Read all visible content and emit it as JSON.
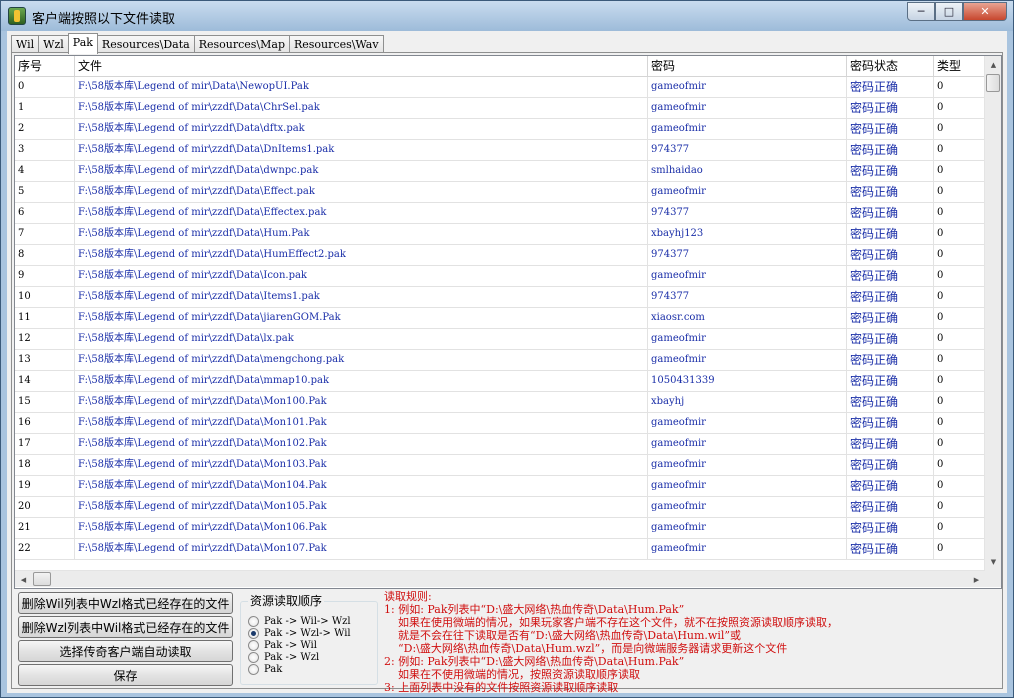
{
  "window": {
    "title": "客户端按照以下文件读取"
  },
  "tabs": [
    {
      "label": "Wil",
      "active": false
    },
    {
      "label": "Wzl",
      "active": false
    },
    {
      "label": "Pak",
      "active": true
    },
    {
      "label": "Resources\\Data",
      "active": false
    },
    {
      "label": "Resources\\Map",
      "active": false
    },
    {
      "label": "Resources\\Wav",
      "active": false
    }
  ],
  "grid": {
    "columns": [
      "序号",
      "文件",
      "密码",
      "密码状态",
      "类型"
    ],
    "rows": [
      [
        "0",
        "F:\\58版本库\\Legend of mir\\Data\\NewopUI.Pak",
        "gameofmir",
        "密码正确",
        "0"
      ],
      [
        "1",
        "F:\\58版本库\\Legend of mir\\zzdf\\Data\\ChrSel.pak",
        "gameofmir",
        "密码正确",
        "0"
      ],
      [
        "2",
        "F:\\58版本库\\Legend of mir\\zzdf\\Data\\dftx.pak",
        "gameofmir",
        "密码正确",
        "0"
      ],
      [
        "3",
        "F:\\58版本库\\Legend of mir\\zzdf\\Data\\DnItems1.pak",
        "974377",
        "密码正确",
        "0"
      ],
      [
        "4",
        "F:\\58版本库\\Legend of mir\\zzdf\\Data\\dwnpc.pak",
        "smlhaidao",
        "密码正确",
        "0"
      ],
      [
        "5",
        "F:\\58版本库\\Legend of mir\\zzdf\\Data\\Effect.pak",
        "gameofmir",
        "密码正确",
        "0"
      ],
      [
        "6",
        "F:\\58版本库\\Legend of mir\\zzdf\\Data\\Effectex.pak",
        "974377",
        "密码正确",
        "0"
      ],
      [
        "7",
        "F:\\58版本库\\Legend of mir\\zzdf\\Data\\Hum.Pak",
        "xbayhj123",
        "密码正确",
        "0"
      ],
      [
        "8",
        "F:\\58版本库\\Legend of mir\\zzdf\\Data\\HumEffect2.pak",
        "974377",
        "密码正确",
        "0"
      ],
      [
        "9",
        "F:\\58版本库\\Legend of mir\\zzdf\\Data\\Icon.pak",
        "gameofmir",
        "密码正确",
        "0"
      ],
      [
        "10",
        "F:\\58版本库\\Legend of mir\\zzdf\\Data\\Items1.pak",
        "974377",
        "密码正确",
        "0"
      ],
      [
        "11",
        "F:\\58版本库\\Legend of mir\\zzdf\\Data\\jiarenGOM.Pak",
        "xiaosr.com",
        "密码正确",
        "0"
      ],
      [
        "12",
        "F:\\58版本库\\Legend of mir\\zzdf\\Data\\lx.pak",
        "gameofmir",
        "密码正确",
        "0"
      ],
      [
        "13",
        "F:\\58版本库\\Legend of mir\\zzdf\\Data\\mengchong.pak",
        "gameofmir",
        "密码正确",
        "0"
      ],
      [
        "14",
        "F:\\58版本库\\Legend of mir\\zzdf\\Data\\mmap10.pak",
        "1050431339",
        "密码正确",
        "0"
      ],
      [
        "15",
        "F:\\58版本库\\Legend of mir\\zzdf\\Data\\Mon100.Pak",
        "xbayhj",
        "密码正确",
        "0"
      ],
      [
        "16",
        "F:\\58版本库\\Legend of mir\\zzdf\\Data\\Mon101.Pak",
        "gameofmir",
        "密码正确",
        "0"
      ],
      [
        "17",
        "F:\\58版本库\\Legend of mir\\zzdf\\Data\\Mon102.Pak",
        "gameofmir",
        "密码正确",
        "0"
      ],
      [
        "18",
        "F:\\58版本库\\Legend of mir\\zzdf\\Data\\Mon103.Pak",
        "gameofmir",
        "密码正确",
        "0"
      ],
      [
        "19",
        "F:\\58版本库\\Legend of mir\\zzdf\\Data\\Mon104.Pak",
        "gameofmir",
        "密码正确",
        "0"
      ],
      [
        "20",
        "F:\\58版本库\\Legend of mir\\zzdf\\Data\\Mon105.Pak",
        "gameofmir",
        "密码正确",
        "0"
      ],
      [
        "21",
        "F:\\58版本库\\Legend of mir\\zzdf\\Data\\Mon106.Pak",
        "gameofmir",
        "密码正确",
        "0"
      ],
      [
        "22",
        "F:\\58版本库\\Legend of mir\\zzdf\\Data\\Mon107.Pak",
        "gameofmir",
        "密码正确",
        "0"
      ]
    ]
  },
  "buttons": {
    "delete_wil": "删除Wil列表中Wzl格式已经存在的文件",
    "delete_wzl": "删除Wzl列表中Wil格式已经存在的文件",
    "select_client": "选择传奇客户端自动读取",
    "save": "保存"
  },
  "read_order": {
    "title": "资源读取顺序",
    "options": [
      {
        "label": "Pak -> Wil-> Wzl",
        "checked": false
      },
      {
        "label": "Pak -> Wzl-> Wil",
        "checked": true
      },
      {
        "label": "Pak -> Wil",
        "checked": false
      },
      {
        "label": "Pak -> Wzl",
        "checked": false
      },
      {
        "label": "Pak",
        "checked": false
      }
    ]
  },
  "rules": {
    "lines": [
      "读取规则:",
      "1: 例如: Pak列表中“D:\\盛大网络\\热血传奇\\Data\\Hum.Pak”",
      "如果在使用微端的情况，如果玩家客户端不存在这个文件，就不在按照资源读取顺序读取，",
      "就是不会在往下读取是否有“D:\\盛大网络\\热血传奇\\Data\\Hum.wil”或",
      "“D:\\盛大网络\\热血传奇\\Data\\Hum.wzl”，而是向微端服务器请求更新这个文件",
      "2: 例如: Pak列表中“D:\\盛大网络\\热血传奇\\Data\\Hum.Pak”",
      "如果在不使用微端的情况，按照资源读取顺序读取",
      "3: 上面列表中没有的文件按照资源读取顺序读取"
    ]
  }
}
